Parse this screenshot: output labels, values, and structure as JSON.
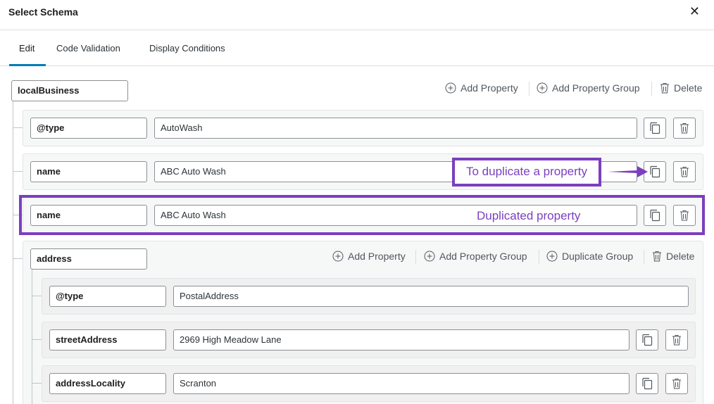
{
  "dialog": {
    "title": "Select Schema",
    "close_icon": "close-icon"
  },
  "tabs": [
    {
      "label": "Edit",
      "active": true
    },
    {
      "label": "Code Validation",
      "active": false
    },
    {
      "label": "Display Conditions",
      "active": false
    }
  ],
  "root": {
    "name": "localBusiness",
    "actions": {
      "add_property": "Add Property",
      "add_property_group": "Add Property Group",
      "delete": "Delete"
    }
  },
  "properties": [
    {
      "key": "@type",
      "value": "AutoWash"
    },
    {
      "key": "name",
      "value": "ABC Auto Wash"
    },
    {
      "key": "name",
      "value": "ABC Auto Wash"
    }
  ],
  "group": {
    "name": "address",
    "actions": {
      "add_property": "Add Property",
      "add_property_group": "Add Property Group",
      "duplicate_group": "Duplicate Group",
      "delete": "Delete"
    },
    "properties": [
      {
        "key": "@type",
        "value": "PostalAddress"
      },
      {
        "key": "streetAddress",
        "value": "2969 High Meadow Lane"
      },
      {
        "key": "addressLocality",
        "value": "Scranton"
      }
    ]
  },
  "annotations": {
    "duplicate_hint": "To duplicate a property",
    "duplicated_label": "Duplicated property",
    "color": "#7b3fbf"
  },
  "colors": {
    "accent": "#007cba",
    "row_bg": "#f6f7f7",
    "border": "#8c8f94"
  }
}
